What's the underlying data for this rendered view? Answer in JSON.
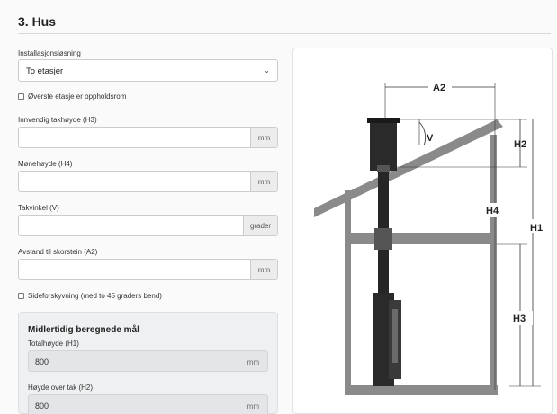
{
  "section": {
    "title": "3. Hus"
  },
  "installation": {
    "label": "Installasjonsløsning",
    "value": "To etasjer"
  },
  "top_floor_checkbox": {
    "label": "Øverste etasje er oppholdsrom",
    "checked": false
  },
  "fields": {
    "inner_ceiling": {
      "label": "Innvendig takhøyde (H3)",
      "value": "",
      "unit": "mm"
    },
    "ridge_height": {
      "label": "Mønehøyde (H4)",
      "value": "",
      "unit": "mm"
    },
    "roof_angle": {
      "label": "Takvinkel (V)",
      "value": "",
      "unit": "grader"
    },
    "chimney_distance": {
      "label": "Avstand til skorstein (A2)",
      "value": "",
      "unit": "mm"
    }
  },
  "side_offset_checkbox": {
    "label": "Sideforskyvning (med to 45 graders bend)",
    "checked": false
  },
  "computed": {
    "title": "Midlertidig beregnede mål",
    "total_height": {
      "label": "Totalhøyde (H1)",
      "value": "800",
      "unit": "mm"
    },
    "above_roof": {
      "label": "Høyde over tak (H2)",
      "value": "800",
      "unit": "mm"
    }
  },
  "diagram_labels": {
    "a2": "A2",
    "v": "V",
    "h1": "H1",
    "h2": "H2",
    "h3": "H3",
    "h4": "H4"
  }
}
